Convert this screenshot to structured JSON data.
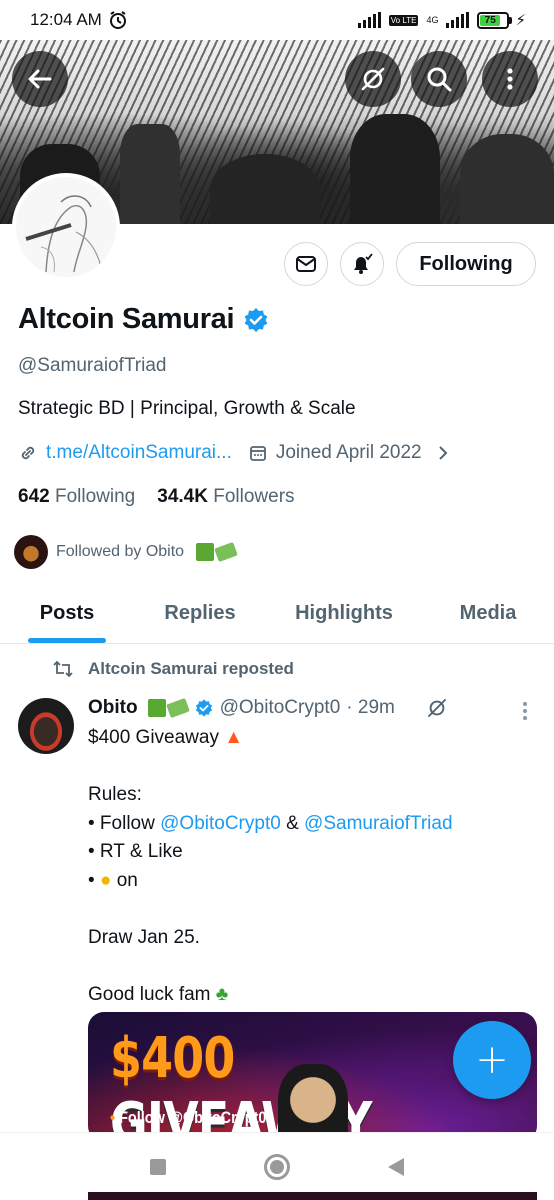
{
  "status_bar": {
    "time": "12:04 AM",
    "volte": "Vo LTE",
    "network": "4G",
    "battery": "75"
  },
  "header": {
    "back_icon": "arrow-left-icon",
    "grok_icon": "grok-icon",
    "search_icon": "search-icon",
    "more_icon": "more-vertical-icon"
  },
  "profile": {
    "display_name": "Altcoin Samurai",
    "verified": true,
    "handle": "@SamuraiofTriad",
    "bio": "Strategic BD | Principal, Growth & Scale",
    "link": "t.me/AltcoinSamurai...",
    "joined": "Joined April 2022",
    "following_count": "642",
    "following_label": "Following",
    "followers_count": "34.4K",
    "followers_label": "Followers",
    "followed_by": "Followed by Obito",
    "follow_button": "Following"
  },
  "tabs": [
    {
      "label": "Posts",
      "active": true
    },
    {
      "label": "Replies",
      "active": false
    },
    {
      "label": "Highlights",
      "active": false
    },
    {
      "label": "Media",
      "active": false
    }
  ],
  "tweet": {
    "repost_label": "Altcoin Samurai reposted",
    "author_name": "Obito",
    "author_handle": "@ObitoCrypt0",
    "time": "· 29m",
    "line1": "$400 Giveaway",
    "line2": "Rules:",
    "rule1_prefix": "• Follow",
    "rule1_mention1": "@ObitoCrypt0",
    "rule1_amp": "&",
    "rule1_mention2": "@SamuraiofTriad",
    "rule2": "• RT & Like",
    "rule3_prefix": "•",
    "rule3_suffix": "on",
    "line_draw": "Draw Jan 25.",
    "line_luck": "Good luck fam",
    "media": {
      "amount": "$400",
      "title": "GIVEAWAY",
      "subtitle": "Follow @ObitoCrypt0"
    }
  },
  "colors": {
    "accent": "#1d9bf0",
    "text_primary": "#0f1419",
    "text_secondary": "#536471"
  }
}
